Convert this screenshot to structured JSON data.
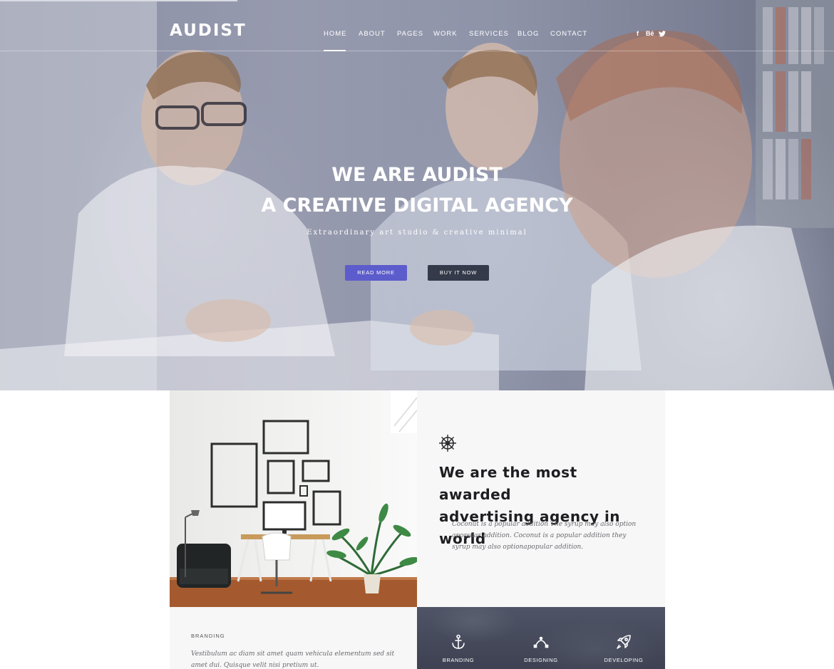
{
  "brand": {
    "logo": "AUDIST"
  },
  "nav": {
    "items": [
      {
        "label": "HOME",
        "active": true
      },
      {
        "label": "ABOUT"
      },
      {
        "label": "PAGES"
      },
      {
        "label": "WORK"
      },
      {
        "label": "SERVICES"
      },
      {
        "label": "BLOG"
      },
      {
        "label": "CONTACT"
      }
    ]
  },
  "social": {
    "facebook": "f",
    "behance": "Bē",
    "twitter": "twitter-icon"
  },
  "hero": {
    "title_line1": "WE ARE AUDIST",
    "title_line2": "A CREATIVE DIGITAL AGENCY",
    "subtitle": "Extraordinary art studio & creative minimal",
    "primary_button": "READ MORE",
    "secondary_button": "BUY IT NOW"
  },
  "about": {
    "icon": "ship-wheel-icon",
    "heading_line1": "We are the most awarded",
    "heading_line2": "advertising agency in world",
    "body": "Coconut is a popular addition The syrup may also option apopular addition. Coconut is a popular addition they syrup may also optionapopular addition."
  },
  "branding": {
    "label": "BRANDING",
    "body": "Vestibulum ac diam sit amet quam vehicula elementum sed sit amet dui. Quisque velit nisi pretium ut."
  },
  "services": [
    {
      "icon": "anchor-icon",
      "label": "BRANDING"
    },
    {
      "icon": "bezier-pen-icon",
      "label": "DESIGNING"
    },
    {
      "icon": "rocket-icon",
      "label": "DEVELOPING"
    }
  ],
  "colors": {
    "accent": "#5c5ccc",
    "dark_button": "#353a4a",
    "hero_overlay": "#484c6e",
    "heading": "#1e1e22",
    "services_bg": "#454a5c"
  }
}
